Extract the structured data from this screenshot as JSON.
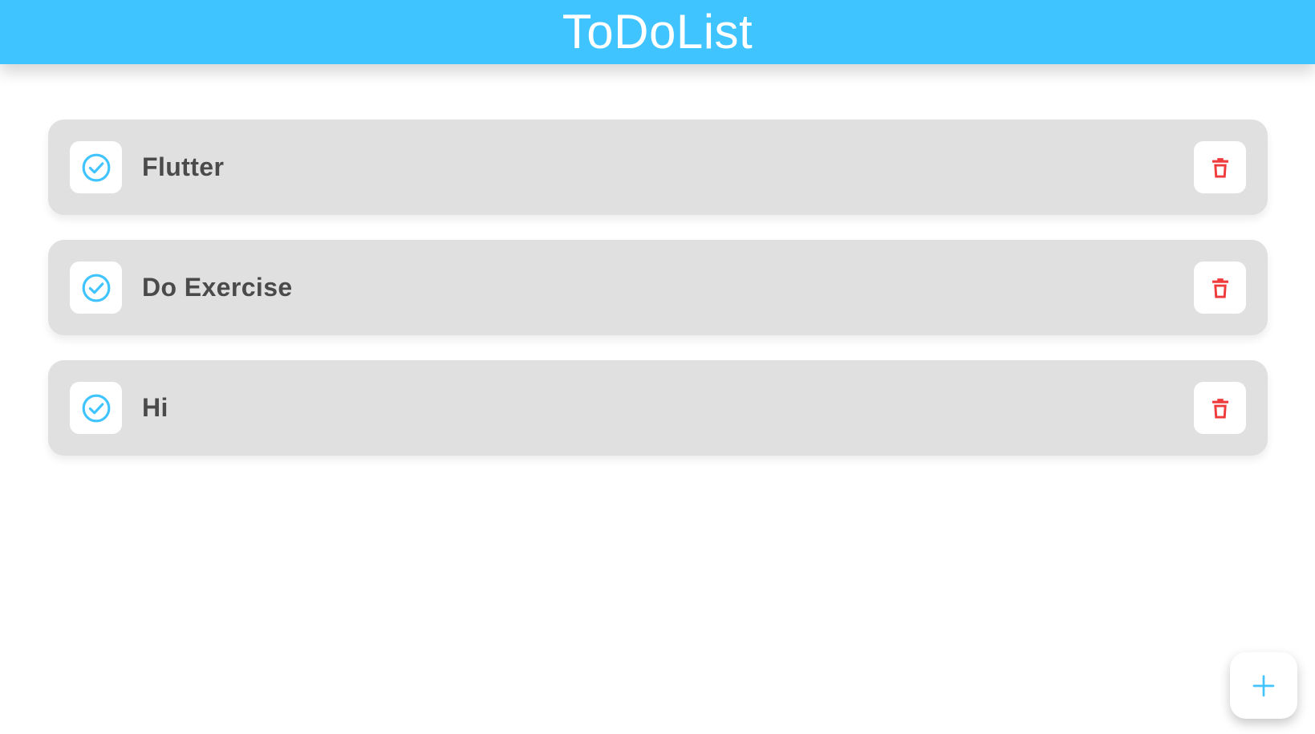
{
  "app_bar": {
    "title": "ToDoList",
    "background_color": "#40c4ff",
    "title_color": "#ffffff"
  },
  "todos": [
    {
      "label": "Flutter",
      "done_icon": "check-circle-icon",
      "delete_icon": "trash-icon"
    },
    {
      "label": "Do Exercise",
      "done_icon": "check-circle-icon",
      "delete_icon": "trash-icon"
    },
    {
      "label": "Hi",
      "done_icon": "check-circle-icon",
      "delete_icon": "trash-icon"
    }
  ],
  "colors": {
    "accent": "#40c4ff",
    "danger": "#ef3b3b",
    "card_background": "#e0e0e0",
    "text": "#4a4a4a"
  },
  "fab": {
    "icon": "plus-icon"
  }
}
